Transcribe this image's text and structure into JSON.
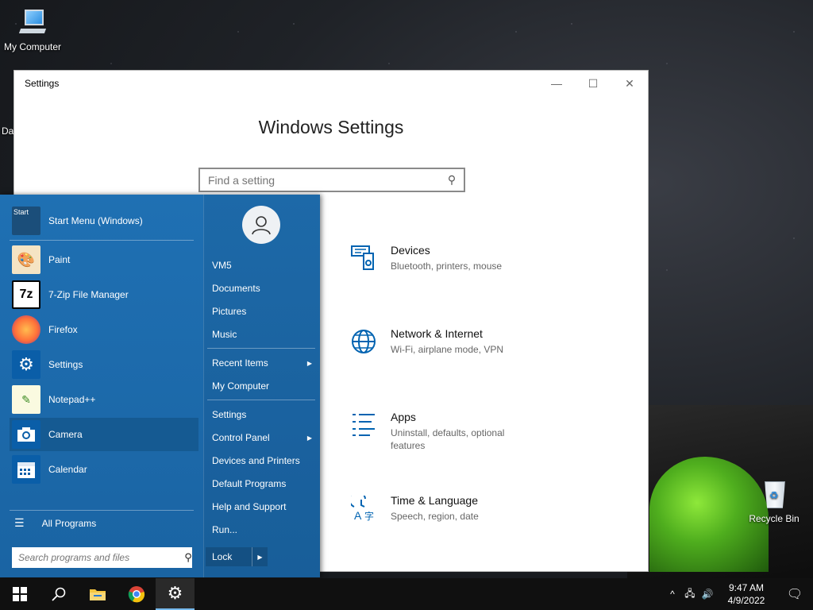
{
  "desktop": {
    "icons": [
      {
        "label": "My Computer"
      },
      {
        "label": "Recycle Bin"
      }
    ],
    "partial_label": "Da"
  },
  "window": {
    "title": "Settings",
    "controls": {
      "minimize": "—",
      "maximize": "☐",
      "close": "✕"
    },
    "heading": "Windows Settings",
    "search_placeholder": "Find a setting",
    "tiles": [
      {
        "title": "Devices",
        "subtitle": "Bluetooth, printers, mouse",
        "icon": "devices-icon"
      },
      {
        "title": "Network & Internet",
        "subtitle": "Wi-Fi, airplane mode, VPN",
        "icon": "globe-icon"
      },
      {
        "title": "Apps",
        "subtitle": "Uninstall, defaults, optional features",
        "icon": "apps-list-icon"
      },
      {
        "title": "Time & Language",
        "subtitle": "Speech, region, date",
        "icon": "time-language-icon"
      }
    ]
  },
  "start_menu": {
    "apps": [
      {
        "label": "Start Menu (Windows)",
        "icon": "start-menu-icon",
        "badge": "Start"
      },
      {
        "label": "Paint",
        "icon": "paint-icon"
      },
      {
        "label": "7-Zip File Manager",
        "icon": "7zip-icon",
        "badge": "7z"
      },
      {
        "label": "Firefox",
        "icon": "firefox-icon"
      },
      {
        "label": "Settings",
        "icon": "gear-icon"
      },
      {
        "label": "Notepad++",
        "icon": "notepad-plus-plus-icon"
      },
      {
        "label": "Camera",
        "icon": "camera-icon",
        "active": true
      },
      {
        "label": "Calendar",
        "icon": "calendar-icon"
      }
    ],
    "all_programs": "All Programs",
    "search_placeholder": "Search programs and files",
    "right_items": [
      {
        "label": "VM5"
      },
      {
        "label": "Documents"
      },
      {
        "label": "Pictures"
      },
      {
        "label": "Music"
      },
      {
        "label": "Recent Items",
        "submenu": true
      },
      {
        "label": "My Computer"
      },
      {
        "label": "Settings"
      },
      {
        "label": "Control Panel",
        "submenu": true
      },
      {
        "label": "Devices and Printers"
      },
      {
        "label": "Default Programs"
      },
      {
        "label": "Help and Support"
      },
      {
        "label": "Run..."
      }
    ],
    "lock_label": "Lock"
  },
  "taskbar": {
    "clock_time": "9:47 AM",
    "clock_date": "4/9/2022",
    "pinned": [
      "windows-start-icon",
      "search-icon",
      "file-explorer-icon",
      "chrome-icon",
      "settings-gear-icon"
    ]
  },
  "colors": {
    "start_menu_bg": "#1f70b3",
    "accent": "#0063b1",
    "taskbar_bg": "#101010"
  }
}
